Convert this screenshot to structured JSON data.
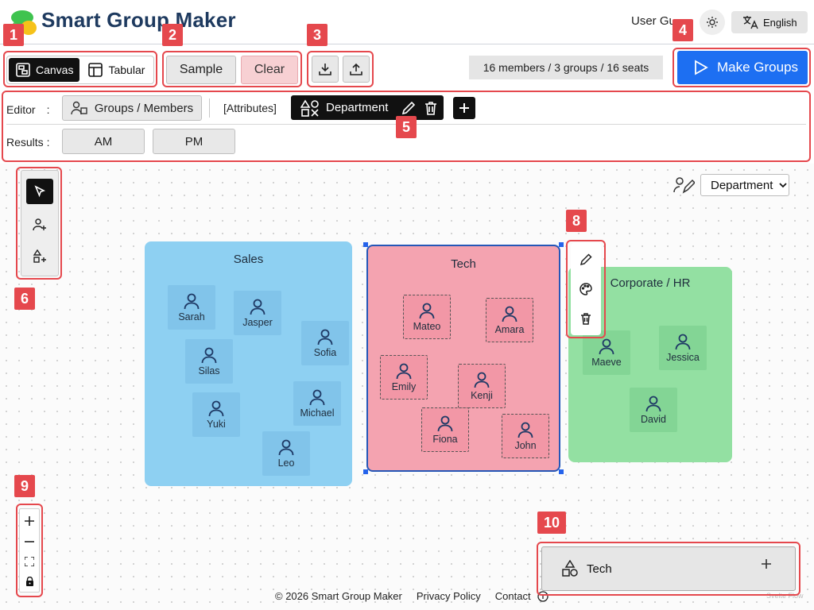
{
  "header": {
    "title": "Smart Group Maker",
    "user_guide": "User Guide",
    "language": "English"
  },
  "toolbar": {
    "view_canvas": "Canvas",
    "view_tabular": "Tabular",
    "sample": "Sample",
    "clear": "Clear",
    "stats": "16 members / 3 groups / 16 seats",
    "make_groups": "Make Groups"
  },
  "editor": {
    "label": "Editor　:",
    "groups_members": "Groups / Members",
    "attributes": "[Attributes]",
    "department": "Department"
  },
  "results": {
    "label": "Results :",
    "am": "AM",
    "pm": "PM"
  },
  "color_by": {
    "selected": "Department"
  },
  "groups": {
    "sales": {
      "title": "Sales",
      "color": "#8ed0f2",
      "members": [
        "Sarah",
        "Jasper",
        "Sofia",
        "Silas",
        "Michael",
        "Yuki",
        "Leo"
      ]
    },
    "tech": {
      "title": "Tech",
      "color": "#f4a3b0",
      "members": [
        "Mateo",
        "Amara",
        "Emily",
        "Kenji",
        "Fiona",
        "John"
      ]
    },
    "hr": {
      "title": "Corporate / HR",
      "color": "#93e0a2",
      "members": [
        "Maeve",
        "Jessica",
        "David"
      ]
    }
  },
  "add_panel": {
    "label": "Tech"
  },
  "footer": {
    "copyright": "© 2026 Smart Group Maker",
    "privacy": "Privacy Policy",
    "contact": "Contact"
  },
  "watermark": "Svelte Flow",
  "annotations": [
    "1",
    "2",
    "3",
    "4",
    "5",
    "6",
    "8",
    "9",
    "10"
  ],
  "colors": {
    "accent": "#1d6ff2",
    "annotation": "#e5484d",
    "clear_bg": "#f7d0d3",
    "selection": "#2557b7"
  }
}
